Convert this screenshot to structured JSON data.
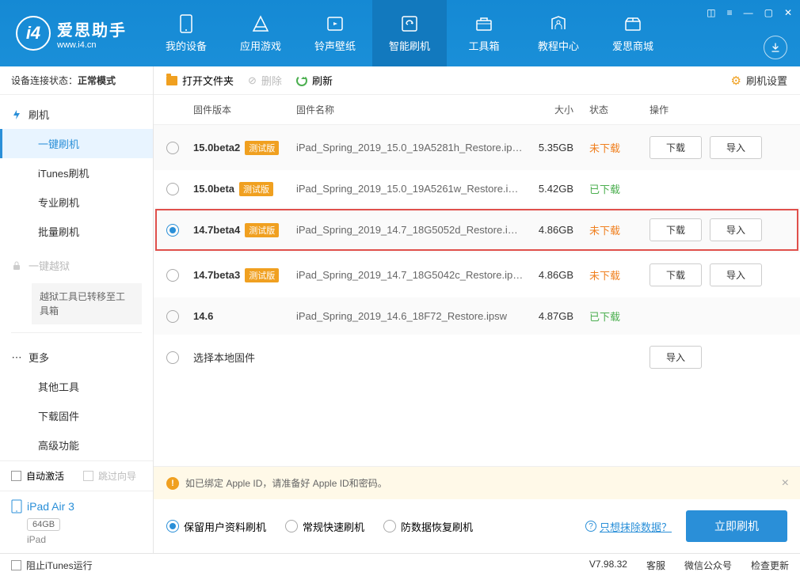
{
  "brand": {
    "title": "爱思助手",
    "sub": "www.i4.cn"
  },
  "nav": {
    "items": [
      {
        "label": "我的设备"
      },
      {
        "label": "应用游戏"
      },
      {
        "label": "铃声壁纸"
      },
      {
        "label": "智能刷机"
      },
      {
        "label": "工具箱"
      },
      {
        "label": "教程中心"
      },
      {
        "label": "爱思商城"
      }
    ]
  },
  "sidebar": {
    "conn_label": "设备连接状态：",
    "conn_value": "正常模式",
    "flash_head": "刷机",
    "flash_items": [
      "一键刷机",
      "iTunes刷机",
      "专业刷机",
      "批量刷机"
    ],
    "jailbreak_head": "一键越狱",
    "jailbreak_note": "越狱工具已转移至工具箱",
    "more_head": "更多",
    "more_items": [
      "其他工具",
      "下载固件",
      "高级功能"
    ],
    "auto_activate": "自动激活",
    "skip_guide": "跳过向导",
    "device_name": "iPad Air 3",
    "device_storage": "64GB",
    "device_type": "iPad",
    "block_itunes": "阻止iTunes运行"
  },
  "toolbar": {
    "open": "打开文件夹",
    "delete": "删除",
    "refresh": "刷新",
    "settings": "刷机设置"
  },
  "table": {
    "headers": {
      "version": "固件版本",
      "name": "固件名称",
      "size": "大小",
      "status": "状态",
      "ops": "操作"
    },
    "beta_tag": "测试版",
    "status_not": "未下载",
    "status_yes": "已下载",
    "download": "下载",
    "import": "导入",
    "select_local": "选择本地固件",
    "rows": [
      {
        "ver": "15.0beta2",
        "beta": true,
        "name": "iPad_Spring_2019_15.0_19A5281h_Restore.ip…",
        "size": "5.35GB",
        "status": "not",
        "sel": false,
        "alt": true,
        "hl": false,
        "ops": true
      },
      {
        "ver": "15.0beta",
        "beta": true,
        "name": "iPad_Spring_2019_15.0_19A5261w_Restore.i…",
        "size": "5.42GB",
        "status": "yes",
        "sel": false,
        "alt": false,
        "hl": false,
        "ops": false
      },
      {
        "ver": "14.7beta4",
        "beta": true,
        "name": "iPad_Spring_2019_14.7_18G5052d_Restore.i…",
        "size": "4.86GB",
        "status": "not",
        "sel": true,
        "alt": true,
        "hl": true,
        "ops": true
      },
      {
        "ver": "14.7beta3",
        "beta": true,
        "name": "iPad_Spring_2019_14.7_18G5042c_Restore.ip…",
        "size": "4.86GB",
        "status": "not",
        "sel": false,
        "alt": false,
        "hl": false,
        "ops": true
      },
      {
        "ver": "14.6",
        "beta": false,
        "name": "iPad_Spring_2019_14.6_18F72_Restore.ipsw",
        "size": "4.87GB",
        "status": "yes",
        "sel": false,
        "alt": true,
        "hl": false,
        "ops": false
      }
    ]
  },
  "info": {
    "text": "如已绑定 Apple ID，请准备好 Apple ID和密码。"
  },
  "action": {
    "modes": [
      "保留用户资料刷机",
      "常规快速刷机",
      "防数据恢复刷机"
    ],
    "erase": "只想抹除数据？",
    "flash_now": "立即刷机"
  },
  "status": {
    "version": "V7.98.32",
    "service": "客服",
    "wechat": "微信公众号",
    "update": "检查更新"
  }
}
